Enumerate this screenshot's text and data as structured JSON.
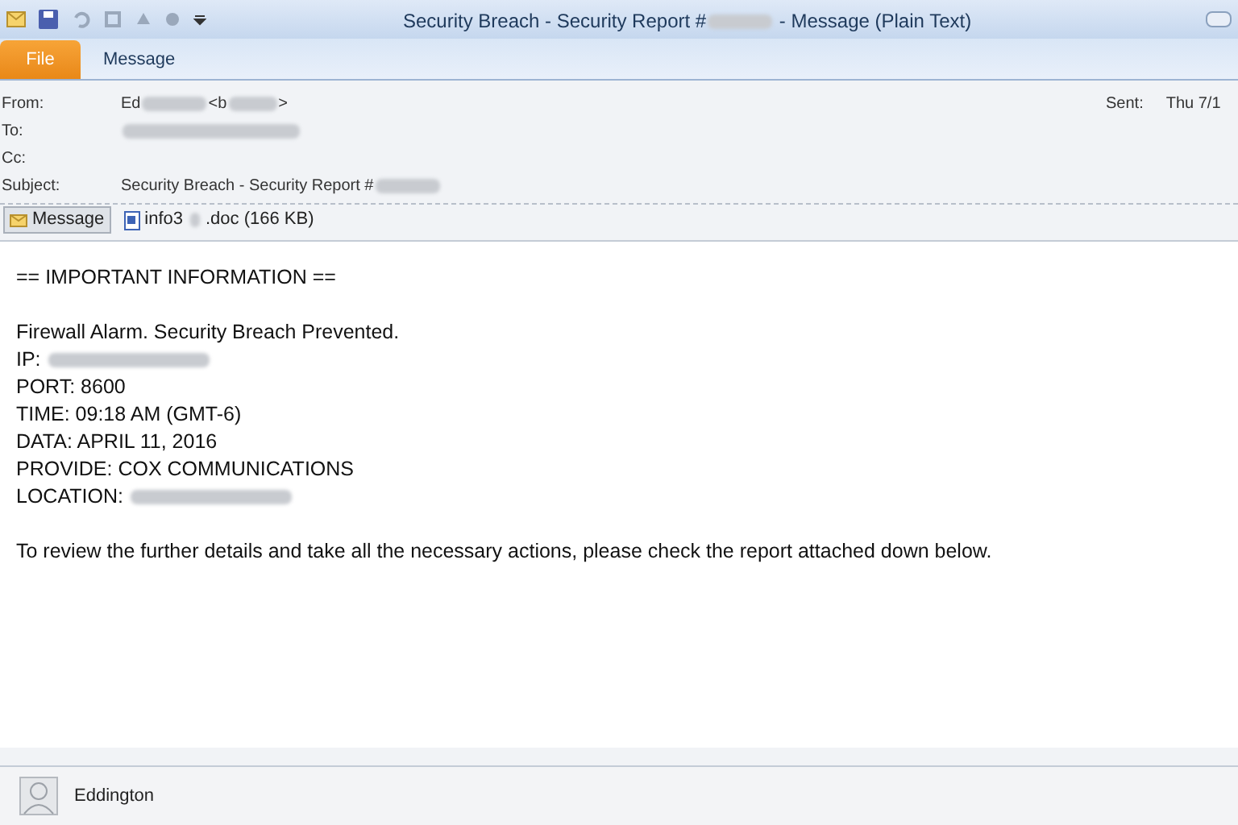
{
  "window": {
    "title": [
      {
        "kind": "text",
        "text": "Security Breach - Security Report #"
      },
      {
        "kind": "redacted"
      },
      {
        "kind": "text",
        "text": " - Message (Plain Text)"
      }
    ]
  },
  "ribbon_tabs": [
    {
      "label": "File",
      "selected": true
    },
    {
      "label": "Message",
      "selected": false
    }
  ],
  "header": {
    "fields": [
      {
        "label": "From:",
        "parts": [
          {
            "kind": "text",
            "text": "Ed"
          },
          {
            "kind": "redacted"
          },
          {
            "kind": "text",
            "text": "<b"
          },
          {
            "kind": "redacted"
          },
          {
            "kind": "text",
            "text": ">"
          }
        ]
      },
      {
        "label": "To:",
        "parts": [
          {
            "kind": "redacted"
          }
        ]
      },
      {
        "label": "Cc:"
      },
      {
        "label": "Subject:",
        "parts": [
          {
            "kind": "text",
            "text": "Security Breach - Security Report #"
          },
          {
            "kind": "redacted"
          }
        ]
      }
    ],
    "sent_label": "Sent:",
    "sent_value": "Thu 7/1"
  },
  "attachments": [
    {
      "label": "Message",
      "selected": true,
      "kind": "message"
    },
    {
      "label": "info3",
      "kind": "doc",
      "suffix": ".doc (166 KB)",
      "selected": false
    }
  ],
  "body": [
    {
      "kind": "line",
      "text": "== IMPORTANT INFORMATION =="
    },
    {
      "kind": "gap"
    },
    {
      "kind": "line",
      "text": "Firewall Alarm. Security Breach Prevented."
    },
    {
      "kind": "redacted_line",
      "text": "IP: "
    },
    {
      "kind": "line",
      "text": "PORT: 8600"
    },
    {
      "kind": "line",
      "text": "TIME: 09:18 AM (GMT-6)"
    },
    {
      "kind": "line",
      "text": "DATA: APRIL 11, 2016"
    },
    {
      "kind": "line",
      "text": "PROVIDE: COX COMMUNICATIONS"
    },
    {
      "kind": "redacted_line",
      "text": "LOCATION: "
    },
    {
      "kind": "gap"
    },
    {
      "kind": "line",
      "text": "To review the further details and take all the necessary actions, please check the report attached down below."
    }
  ],
  "footer": {
    "name": "Eddington"
  }
}
